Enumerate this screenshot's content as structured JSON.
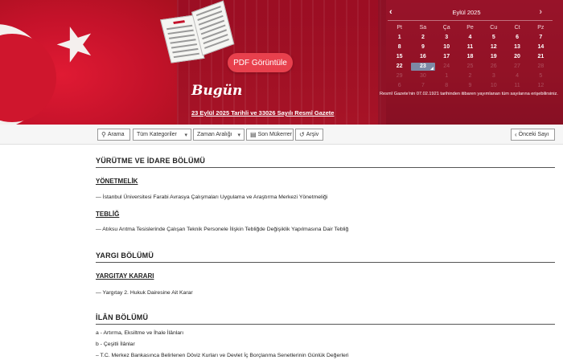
{
  "hero": {
    "pdf_button": "PDF Görüntüle",
    "today_title": "Bugün",
    "today_link": "23 Eylül 2025 Tarihli ve 33026 Sayılı Resmî Gazete"
  },
  "calendar": {
    "prev": "‹",
    "next": "›",
    "month": "Eylül 2025",
    "weekdays": [
      "Pt",
      "Sa",
      "Ça",
      "Pe",
      "Cu",
      "Ct",
      "Pz"
    ],
    "rows": [
      [
        "1",
        "2",
        "3",
        "4",
        "5",
        "6",
        "7"
      ],
      [
        "8",
        "9",
        "10",
        "11",
        "12",
        "13",
        "14"
      ],
      [
        "15",
        "16",
        "17",
        "18",
        "19",
        "20",
        "21"
      ],
      [
        "22",
        "23",
        "24",
        "25",
        "26",
        "27",
        "28"
      ],
      [
        "29",
        "30",
        "1",
        "2",
        "3",
        "4",
        "5"
      ],
      [
        "6",
        "7",
        "8",
        "9",
        "10",
        "11",
        "12"
      ]
    ],
    "selected": "23",
    "note": "Resmî Gazete'nin 07.02.1921 tarihinden itibaren yayımlanan tüm sayılarına erişebilirsiniz."
  },
  "toolbar": {
    "search": "Arama",
    "category": "Tüm Kategoriler",
    "time_range": "Zaman Aralığı",
    "last_duplicate": "Son Mükerrer",
    "archive": "Arşiv",
    "previous_issue": "Önceki Sayı"
  },
  "sections": {
    "executive": "YÜRÜTME VE İDARE BÖLÜMÜ",
    "regulation": "YÖNETMELİK",
    "regulation_item": "— İstanbul Üniversitesi Farabi Avrasya Çalışmaları Uygulama ve Araştırma Merkezi Yönetmeliği",
    "communique": "TEBLİĞ",
    "communique_item": "— Atıksu Arıtma Tesislerinde Çalışan Teknik Personele İlişkin Tebliğde Değişiklik Yapılmasına Dair Tebliğ",
    "judiciary": "YARGI BÖLÜMÜ",
    "court_decision": "YARGITAY KARARI",
    "court_item": "— Yargıtay 2. Hukuk Dairesine Ait Karar",
    "notice": "İLÂN BÖLÜMÜ",
    "notice_items": [
      "a - Artırma, Eksiltme ve İhale İlânları",
      "b - Çeşitli İlânlar",
      "– T.C. Merkez Bankasınca Belirlenen Döviz Kurları ve Devlet İç Borçlanma Senetlerinin Günlük Değerleri"
    ]
  },
  "colors": {
    "brand_red": "#b3132b",
    "pdf_button": "#e8404d",
    "selected_day": "#7d8aa6"
  }
}
